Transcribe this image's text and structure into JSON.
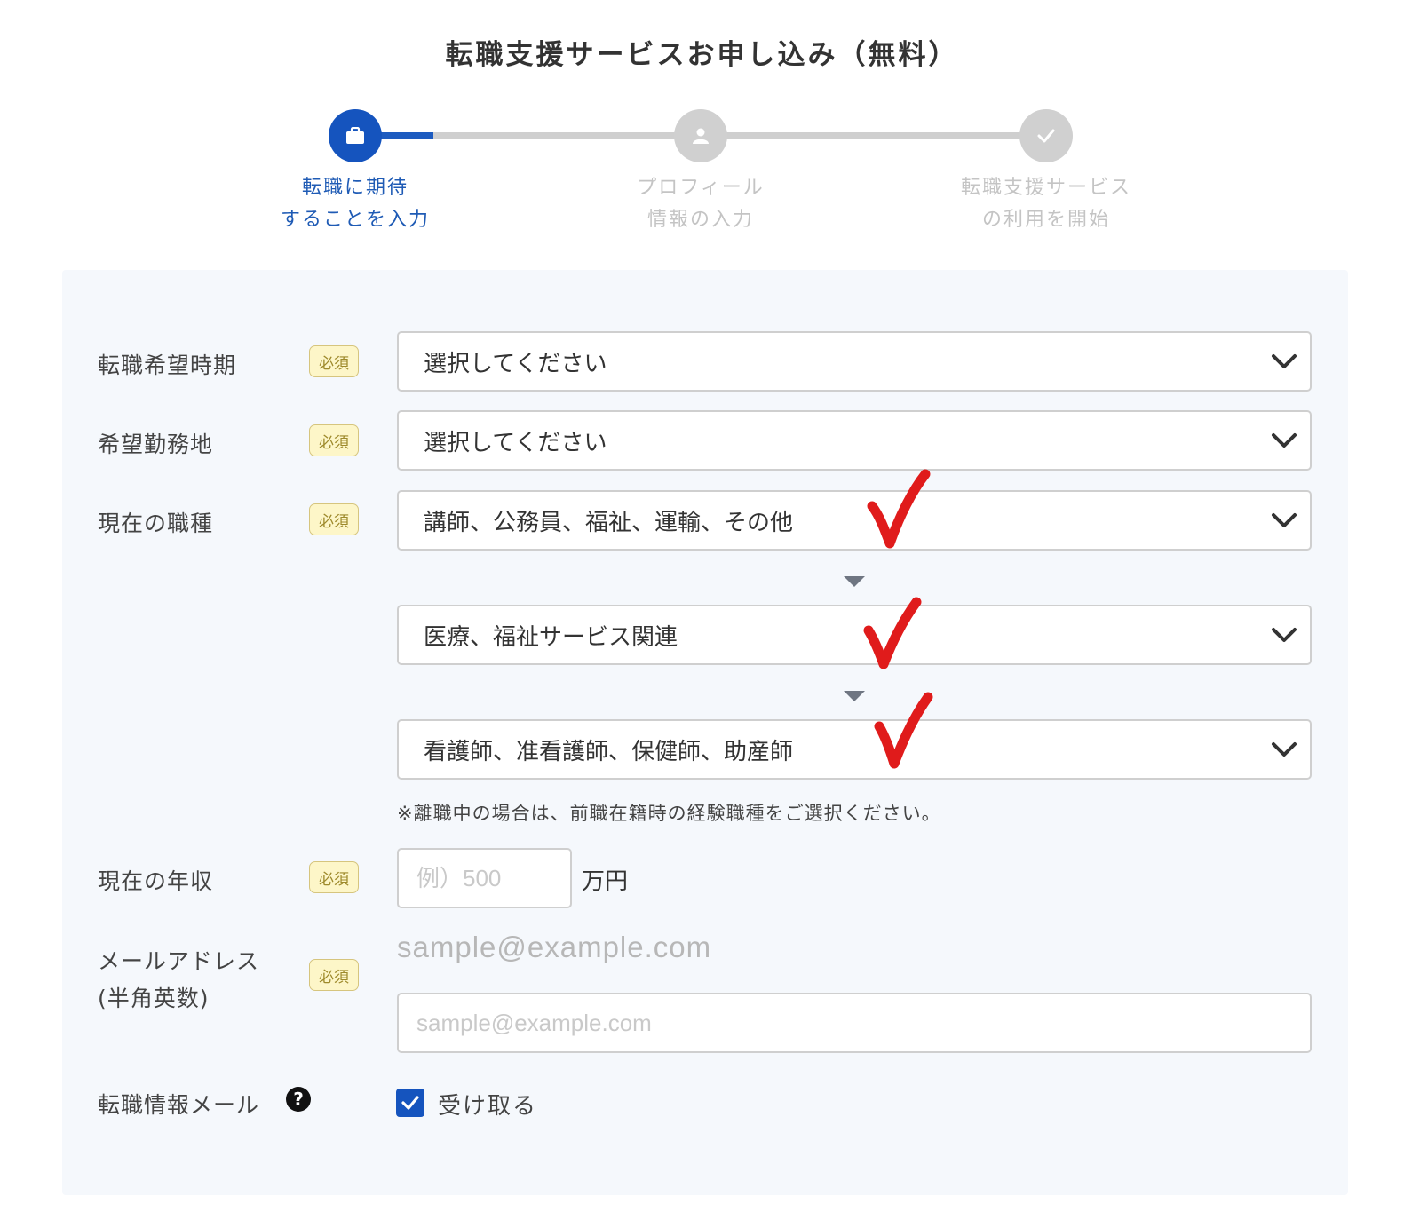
{
  "title": "転職支援サービスお申し込み（無料）",
  "steps": [
    {
      "line1": "転職に期待",
      "line2": "することを入力",
      "icon": "briefcase-icon",
      "state": "active"
    },
    {
      "line1": "プロフィール",
      "line2": "情報の入力",
      "icon": "person-icon",
      "state": "inactive"
    },
    {
      "line1": "転職支援サービス",
      "line2": "の利用を開始",
      "icon": "check-icon",
      "state": "inactive"
    }
  ],
  "required_label": "必須",
  "fields": {
    "timing": {
      "label": "転職希望時期",
      "value": "選択してください"
    },
    "location": {
      "label": "希望勤務地",
      "value": "選択してください"
    },
    "job": {
      "label": "現在の職種",
      "level1": "講師、公務員、福祉、運輸、その他",
      "level2": "医療、福祉サービス関連",
      "level3": "看護師、准看護師、保健師、助産師",
      "note": "※離職中の場合は、前職在籍時の経験職種をご選択ください。"
    },
    "income": {
      "label": "現在の年収",
      "placeholder": "例）500",
      "unit": "万円"
    },
    "email": {
      "label_line1": "メールアドレス",
      "label_line2": "(半角英数)",
      "example": "sample@example.com",
      "placeholder": "sample@example.com"
    },
    "newsletter": {
      "label": "転職情報メール",
      "checkbox_label": "受け取る",
      "checked": true
    }
  },
  "colors": {
    "accent": "#1554be",
    "badge_bg": "#fdf6c8",
    "check_mark": "#e01b1b",
    "panel_bg": "#f5f8fc"
  }
}
